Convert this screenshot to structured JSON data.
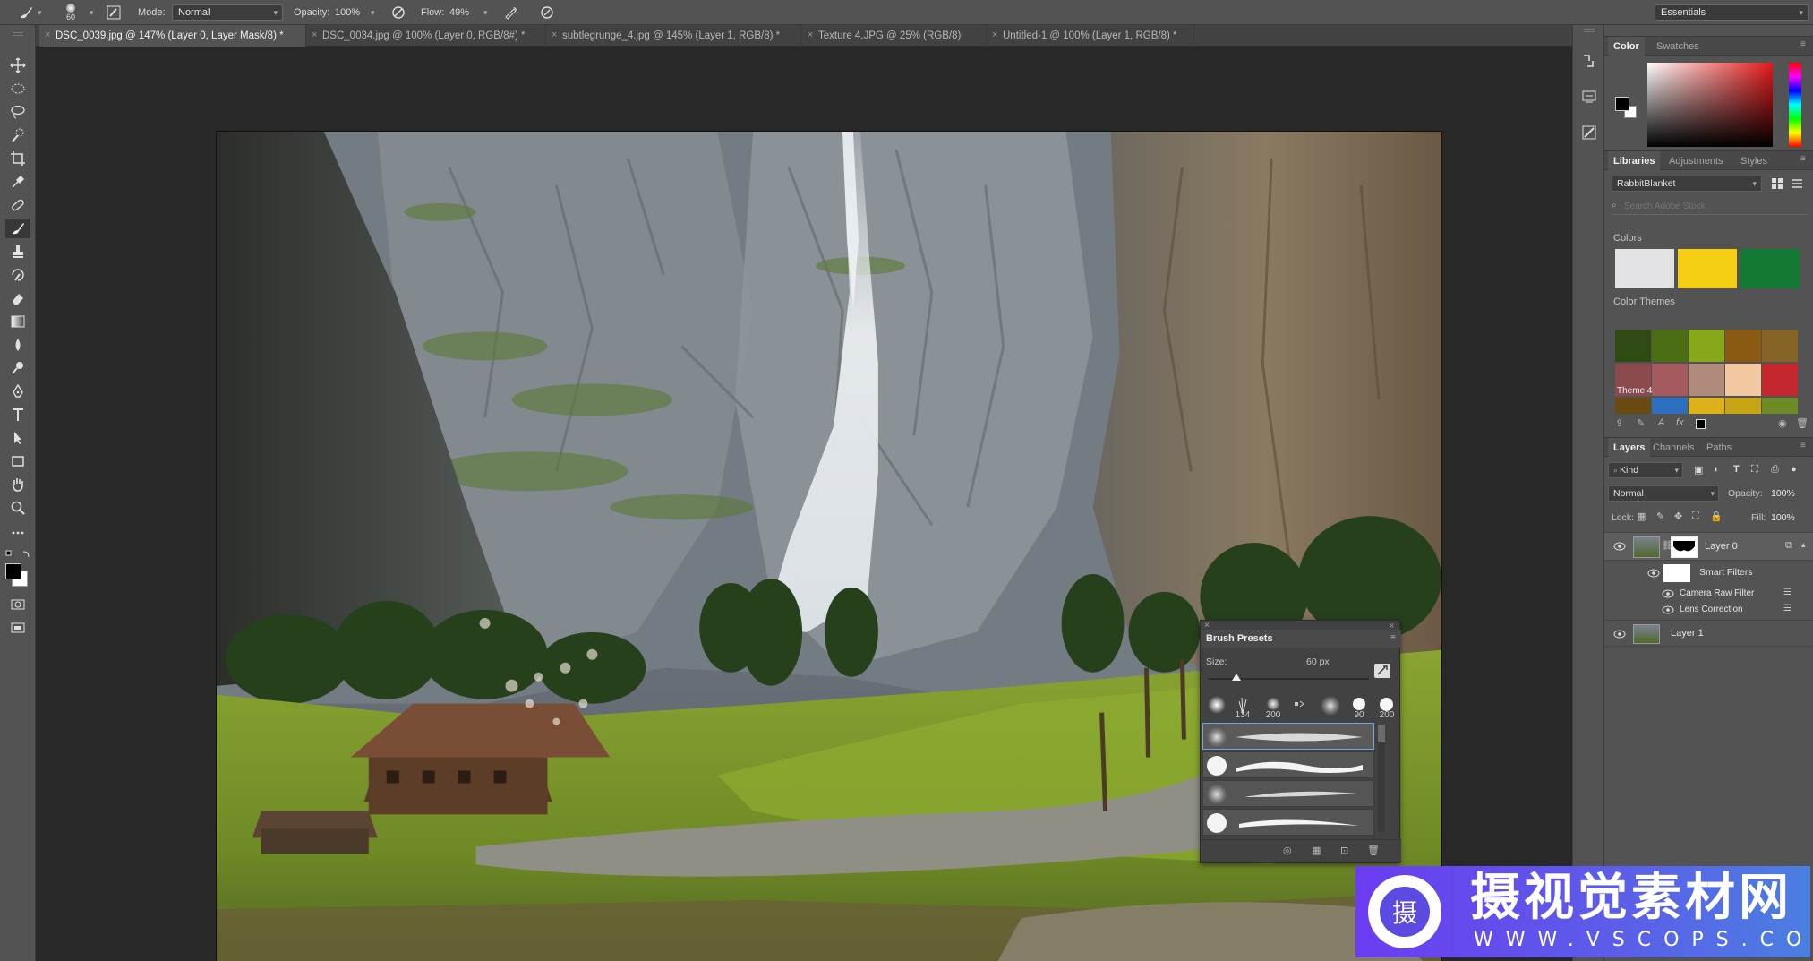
{
  "options_bar": {
    "brush_size": "60",
    "mode_label": "Mode:",
    "mode_value": "Normal",
    "opacity_label": "Opacity:",
    "opacity_value": "100%",
    "flow_label": "Flow:",
    "flow_value": "49%",
    "workspace": "Essentials"
  },
  "tabs": [
    {
      "label": "DSC_0039.jpg @ 147% (Layer 0, Layer Mask/8) *",
      "active": true
    },
    {
      "label": "DSC_0034.jpg @ 100% (Layer 0, RGB/8#) *",
      "active": false
    },
    {
      "label": "subtlegrunge_4.jpg @ 145% (Layer 1, RGB/8) *",
      "active": false
    },
    {
      "label": "Texture 4.JPG @ 25% (RGB/8)",
      "active": false
    },
    {
      "label": "Untitled-1 @ 100% (Layer 1, RGB/8) *",
      "active": false
    }
  ],
  "tools": [
    "move-tool",
    "marquee-tool",
    "lasso-tool",
    "quick-select-tool",
    "crop-tool",
    "eyedropper-tool",
    "healing-brush-tool",
    "brush-tool",
    "clone-stamp-tool",
    "history-brush-tool",
    "eraser-tool",
    "gradient-tool",
    "blur-tool",
    "dodge-tool",
    "pen-tool",
    "type-tool",
    "path-select-tool",
    "rectangle-tool",
    "hand-tool",
    "zoom-tool",
    "more-tools"
  ],
  "color_panel": {
    "tabs": [
      "Color",
      "Swatches"
    ],
    "foreground": "#000000",
    "background": "#ffffff"
  },
  "libraries_panel": {
    "tabs": [
      "Libraries",
      "Adjustments",
      "Styles"
    ],
    "library_name": "RabbitBlanket",
    "search_placeholder": "Search Adobe Stock",
    "colors_label": "Colors",
    "colors": [
      "#e3e3e6",
      "#f5cf14",
      "#127a32"
    ],
    "themes_label": "Color Themes",
    "themes": [
      {
        "colors": [
          "#2f4a12",
          "#4b6e14",
          "#86a81a",
          "#8a5a12",
          "#866428"
        ],
        "name": ""
      },
      {
        "colors": [
          "#8a4a4e",
          "#a45a5e",
          "#b08a7a",
          "#f2c8a0",
          "#c4282e"
        ],
        "name": "Theme 4"
      },
      {
        "colors": [
          "#6a4a10",
          "#2d6fbf",
          "#dcb218",
          "#c8a512",
          "#6e8a28"
        ],
        "name": ""
      }
    ]
  },
  "layers_panel": {
    "tabs": [
      "Layers",
      "Channels",
      "Paths"
    ],
    "filter_kind": "Kind",
    "blend_mode": "Normal",
    "opacity_label": "Opacity:",
    "opacity_value": "100%",
    "lock_label": "Lock:",
    "fill_label": "Fill:",
    "fill_value": "100%",
    "layers": [
      {
        "name": "Layer 0"
      },
      {
        "name": "Smart Filters"
      },
      {
        "name": "Camera Raw Filter"
      },
      {
        "name": "Lens Correction"
      },
      {
        "name": "Layer 1"
      }
    ]
  },
  "brush_presets": {
    "title": "Brush Presets",
    "size_label": "Size:",
    "size_value": "60 px",
    "size_fraction": 0.18,
    "tip_labels": [
      "",
      "134",
      "200",
      "",
      "",
      "90",
      "200"
    ]
  },
  "watermark": {
    "logo_char": "摄",
    "title": "摄视觉素材网",
    "url": "WWW.VSCOPS.COM"
  }
}
